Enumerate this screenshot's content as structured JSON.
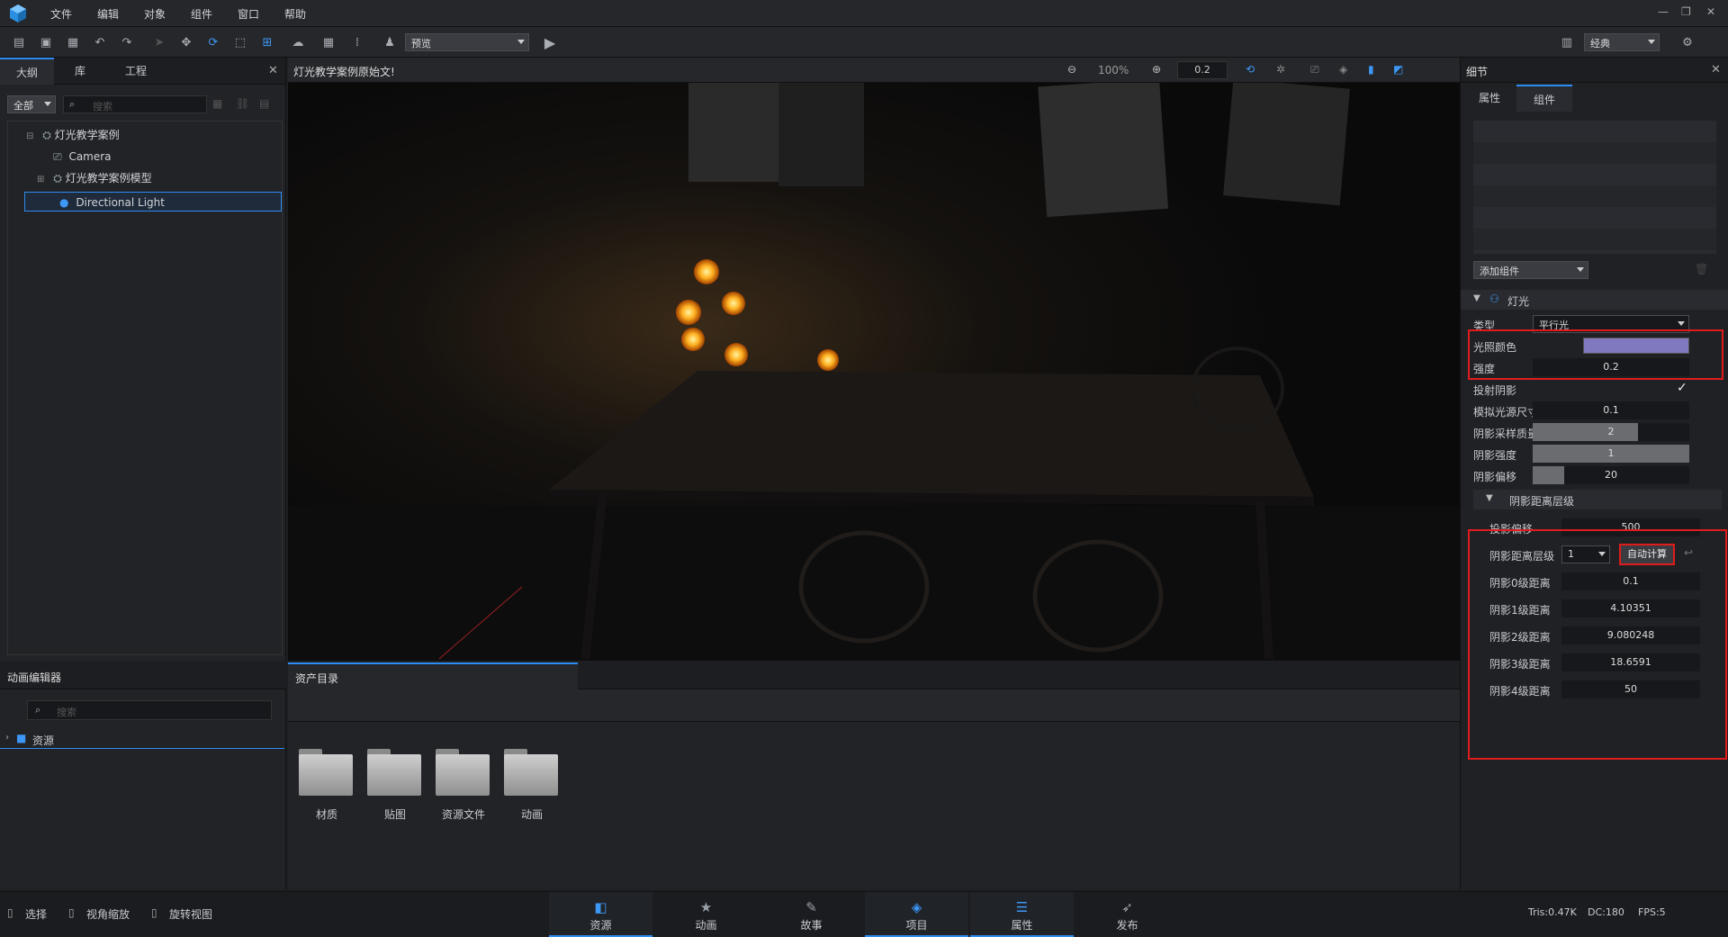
{
  "menu": [
    "文件",
    "编辑",
    "对象",
    "组件",
    "窗口",
    "帮助"
  ],
  "toolbar": {
    "preview_label": "预览",
    "layout_label": "经典"
  },
  "left_panel": {
    "tabs": [
      "大纲",
      "库",
      "工程"
    ],
    "filter_label": "全部",
    "search_placeholder": "搜索",
    "tree": [
      {
        "label": "灯光教学案例"
      },
      {
        "label": "Camera"
      },
      {
        "label": "灯光教学案例模型"
      },
      {
        "label": "Directional Light"
      }
    ]
  },
  "viewport": {
    "title": "灯光教学案例原始文!",
    "zoom": "100%",
    "speed": "0.2"
  },
  "details": {
    "title": "细节",
    "tabs": [
      "属性",
      "组件"
    ],
    "add_component_label": "添加组件",
    "light_section": "灯光",
    "type_label": "类型",
    "type_value": "平行光",
    "color_label": "光照颜色",
    "color_value": "#8079c0",
    "intensity_label": "强度",
    "intensity_value": "0.2",
    "cast_shadow_label": "投射阴影",
    "light_size_label": "模拟光源尺寸",
    "light_size_value": "0.1",
    "shadow_quality_label": "阴影采样质量",
    "shadow_quality_value": "2",
    "shadow_quality_fill": 0.67,
    "shadow_strength_label": "阴影强度",
    "shadow_strength_value": "1",
    "shadow_strength_fill": 1.0,
    "shadow_bias_label": "阴影偏移",
    "shadow_bias_value": "20",
    "shadow_bias_fill": 0.2,
    "cascade_section": "阴影距离层级",
    "proj_offset_label": "投影偏移",
    "proj_offset_value": "500",
    "cascade_level_label": "阴影距离层级",
    "cascade_level_value": "1",
    "auto_calc_label": "自动计算",
    "level0_label": "阴影0级距离",
    "level0_value": "0.1",
    "level1_label": "阴影1级距离",
    "level1_value": "4.10351",
    "level2_label": "阴影2级距离",
    "level2_value": "9.080248",
    "level3_label": "阴影3级距离",
    "level3_value": "18.6591",
    "level4_label": "阴影4级距离",
    "level4_value": "50"
  },
  "anim_panel": {
    "title": "动画编辑器",
    "search_placeholder": "搜索",
    "root_label": "资源"
  },
  "asset_panel": {
    "tab": "资产目录",
    "folders": [
      "材质",
      "贴图",
      "资源文件",
      "动画"
    ]
  },
  "status": {
    "modes": [
      "选择",
      "视角缩放",
      "旋转视图"
    ],
    "tabs": [
      "资源",
      "动画",
      "故事",
      "项目",
      "属性",
      "发布"
    ],
    "tris": "Tris:0.47K",
    "dc": "DC:180",
    "fps": "FPS:5"
  }
}
